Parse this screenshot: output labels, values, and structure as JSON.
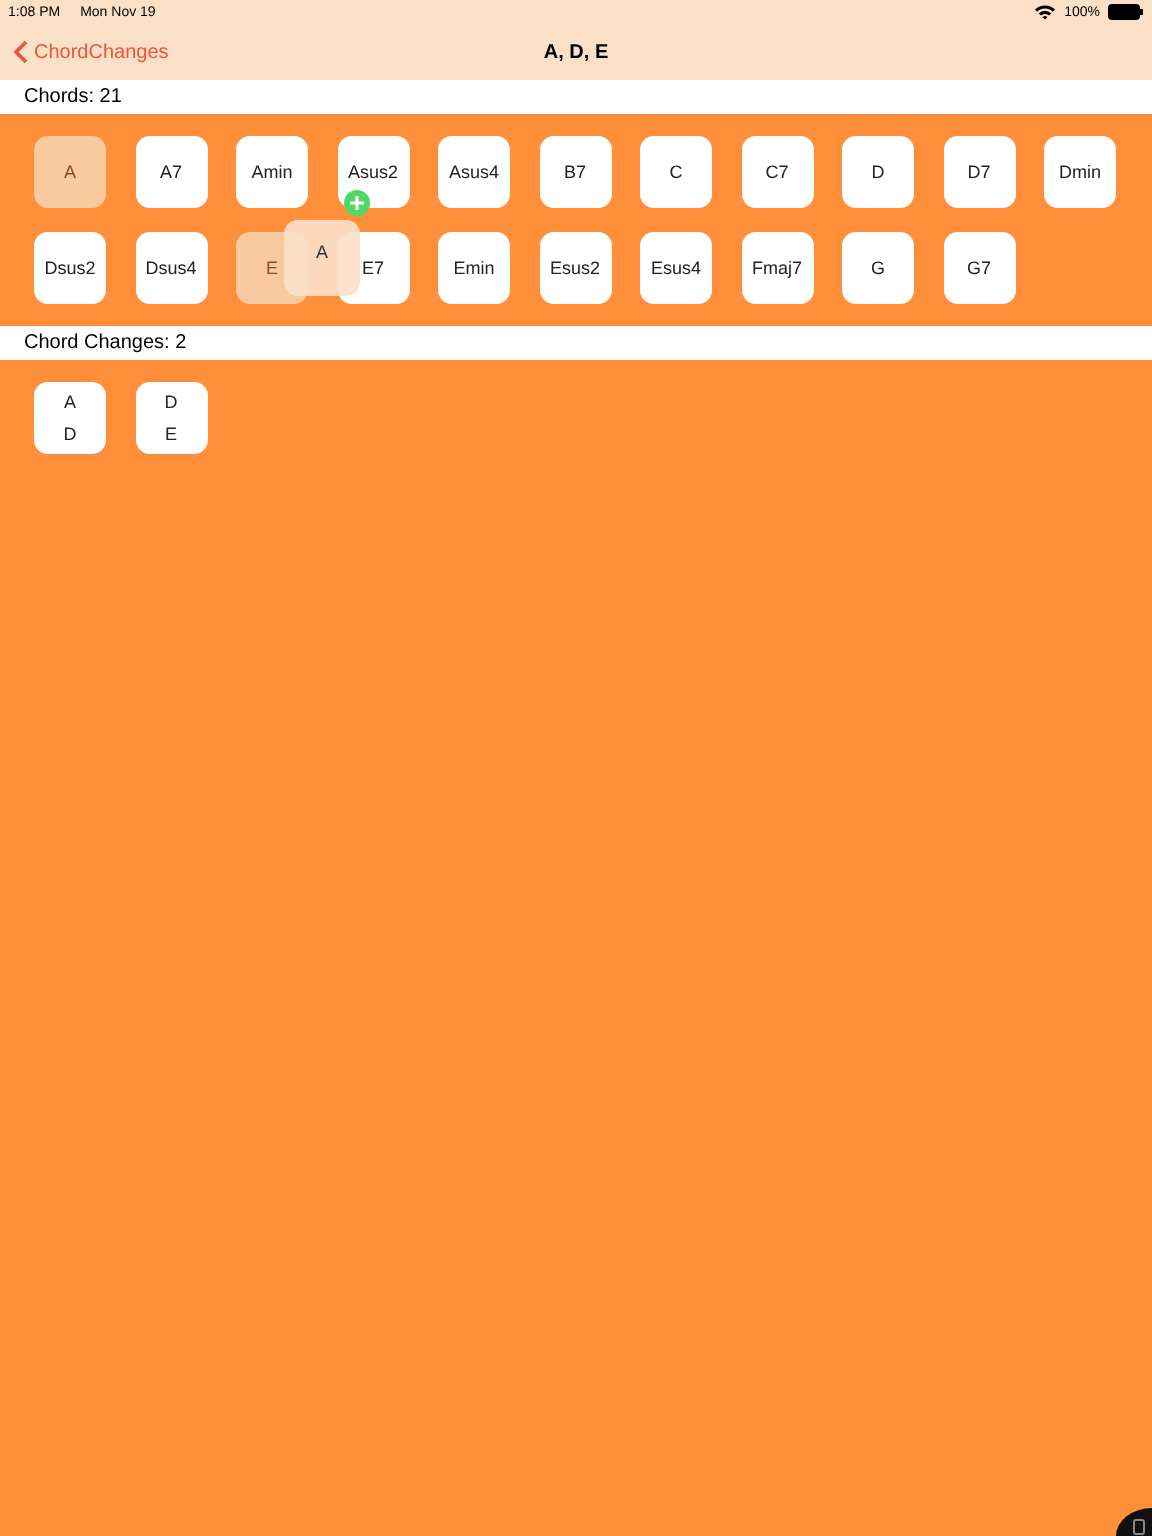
{
  "status_bar": {
    "time": "1:08 PM",
    "date": "Mon Nov 19",
    "battery": "100%"
  },
  "nav": {
    "back": "ChordChanges",
    "title": "A, D, E"
  },
  "chords_header": "Chords: 21",
  "chords": [
    {
      "label": "A",
      "faded": true
    },
    {
      "label": "A7",
      "faded": false
    },
    {
      "label": "Amin",
      "faded": false
    },
    {
      "label": "Asus2",
      "faded": false
    },
    {
      "label": "Asus4",
      "faded": false
    },
    {
      "label": "B7",
      "faded": false
    },
    {
      "label": "C",
      "faded": false
    },
    {
      "label": "C7",
      "faded": false
    },
    {
      "label": "D",
      "faded": false
    },
    {
      "label": "D7",
      "faded": false
    },
    {
      "label": "Dmin",
      "faded": false
    },
    {
      "label": "Dsus2",
      "faded": false
    },
    {
      "label": "Dsus4",
      "faded": false
    },
    {
      "label": "E",
      "faded": true
    },
    {
      "label": "E7",
      "faded": false
    },
    {
      "label": "Emin",
      "faded": false
    },
    {
      "label": "Esus2",
      "faded": false
    },
    {
      "label": "Esus4",
      "faded": false
    },
    {
      "label": "Fmaj7",
      "faded": false
    },
    {
      "label": "G",
      "faded": false
    },
    {
      "label": "G7",
      "faded": false
    }
  ],
  "drag_preview": {
    "label": "A"
  },
  "changes_header": "Chord Changes: 2",
  "changes": [
    {
      "first": "A",
      "second": "D"
    },
    {
      "first": "D",
      "second": "E"
    }
  ]
}
